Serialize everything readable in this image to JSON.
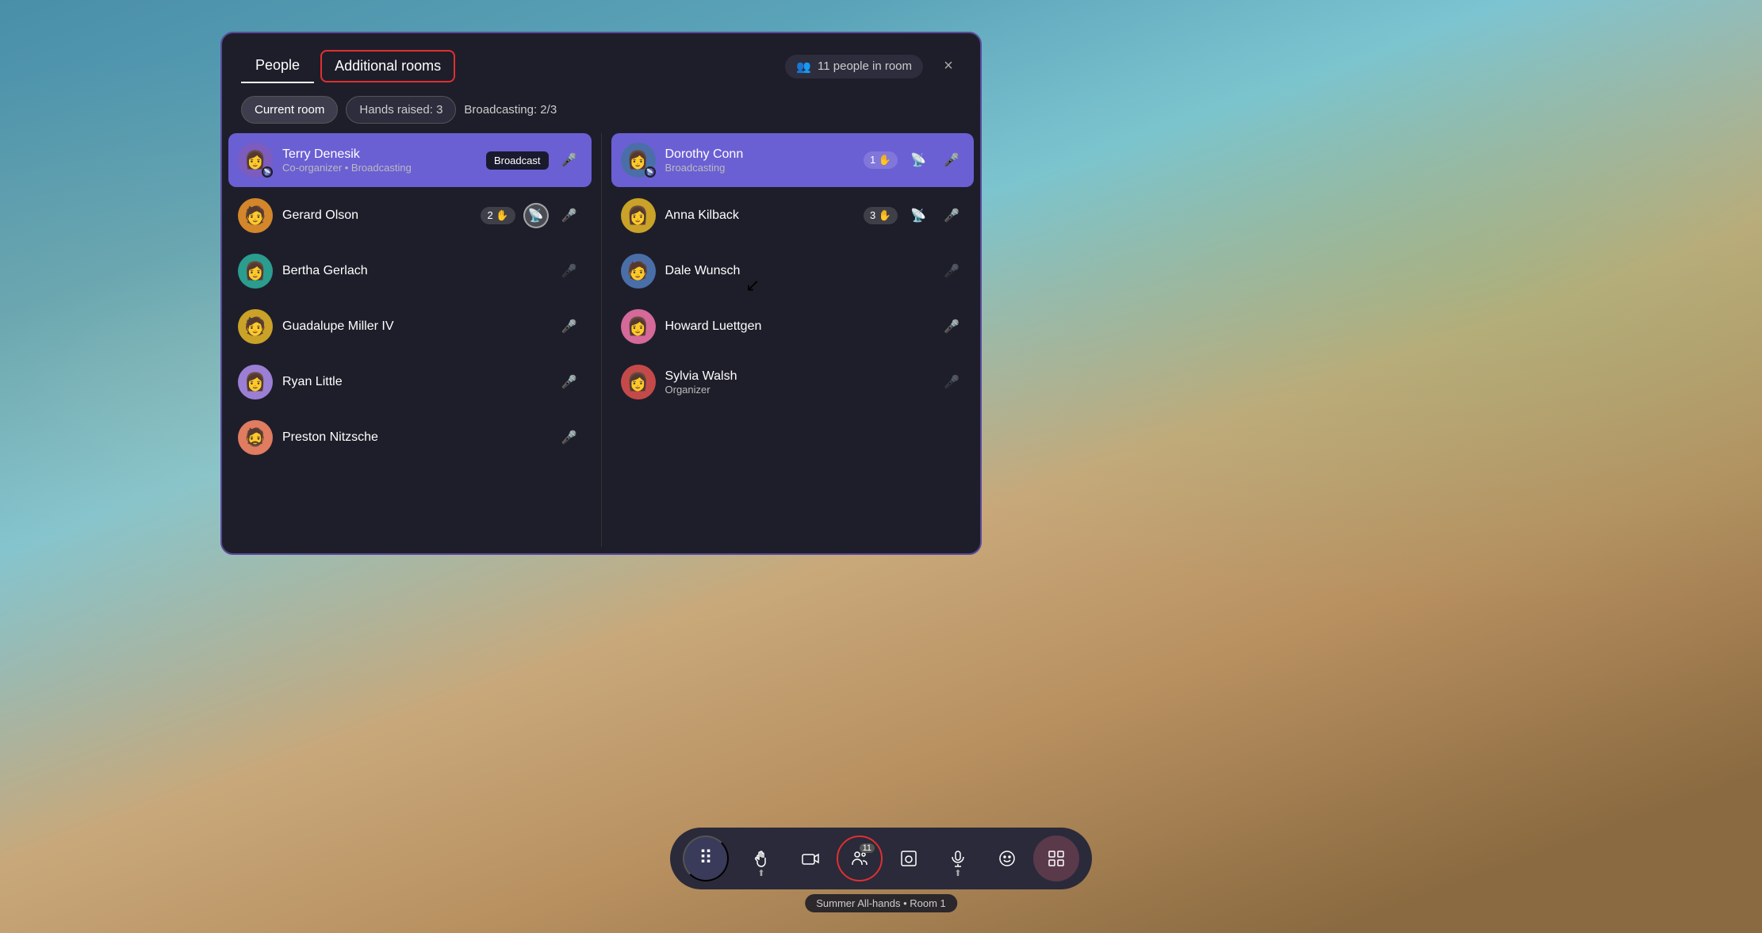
{
  "tabs": {
    "people": {
      "label": "People",
      "active": false
    },
    "additional_rooms": {
      "label": "Additional rooms",
      "active": true
    }
  },
  "header": {
    "people_count": "11 people in room",
    "close_label": "×"
  },
  "filters": {
    "current_room": "Current room",
    "hands_raised": "Hands raised: 3",
    "broadcasting": "Broadcasting: 2/3"
  },
  "left_column": [
    {
      "name": "Terry Denesik",
      "role": "Co-organizer • Broadcasting",
      "tag": "Broadcast",
      "broadcasting": true,
      "avatar_color": "av-purple",
      "avatar_emoji": "👤",
      "mic": "active",
      "has_broadcast_dot": true
    },
    {
      "name": "Gerard Olson",
      "role": "",
      "broadcasting": false,
      "avatar_color": "av-orange",
      "avatar_emoji": "👤",
      "hand_count": "2",
      "mic": "active",
      "has_broadcast_dot": false,
      "broadcast_btn_active": true
    },
    {
      "name": "Bertha Gerlach",
      "role": "",
      "broadcasting": false,
      "avatar_color": "av-teal",
      "avatar_emoji": "👤",
      "mic": "muted",
      "has_broadcast_dot": false
    },
    {
      "name": "Guadalupe Miller IV",
      "role": "",
      "broadcasting": false,
      "avatar_color": "av-gold",
      "avatar_emoji": "👤",
      "mic": "active",
      "has_broadcast_dot": false
    },
    {
      "name": "Ryan Little",
      "role": "",
      "broadcasting": false,
      "avatar_color": "av-lavender",
      "avatar_emoji": "👤",
      "mic": "active",
      "has_broadcast_dot": false
    },
    {
      "name": "Preston Nitzsche",
      "role": "",
      "broadcasting": false,
      "avatar_color": "av-peach",
      "avatar_emoji": "👤",
      "mic": "active",
      "has_broadcast_dot": false
    }
  ],
  "right_column": [
    {
      "name": "Dorothy Conn",
      "role": "Broadcasting",
      "broadcasting": true,
      "avatar_color": "av-blue",
      "avatar_emoji": "👤",
      "hand_count": "1",
      "mic": "active",
      "has_broadcast_dot": true,
      "has_broadcast_icon": true
    },
    {
      "name": "Anna Kilback",
      "role": "",
      "broadcasting": false,
      "avatar_color": "av-gold",
      "avatar_emoji": "👤",
      "hand_count": "3",
      "mic": "active",
      "has_broadcast_dot": false,
      "has_broadcast_icon": true
    },
    {
      "name": "Dale Wunsch",
      "role": "",
      "broadcasting": false,
      "avatar_color": "av-blue",
      "avatar_emoji": "👤",
      "mic": "muted",
      "has_broadcast_dot": false
    },
    {
      "name": "Howard Luettgen",
      "role": "",
      "broadcasting": false,
      "avatar_color": "av-pink",
      "avatar_emoji": "👤",
      "mic": "active",
      "has_broadcast_dot": false
    },
    {
      "name": "Sylvia Walsh",
      "role": "Organizer",
      "broadcasting": false,
      "avatar_color": "av-red",
      "avatar_emoji": "👤",
      "mic": "muted",
      "has_broadcast_dot": false
    }
  ],
  "toolbar": {
    "apps_icon": "⠿",
    "raise_hand_icon": "⬆",
    "camera_icon": "🎥",
    "people_icon": "👤",
    "people_count": "11",
    "screenshot_icon": "📷",
    "mic_icon": "🎤",
    "emoji_icon": "😊",
    "more_icon": "⊞"
  },
  "room_label": "Summer All-hands • Room 1"
}
